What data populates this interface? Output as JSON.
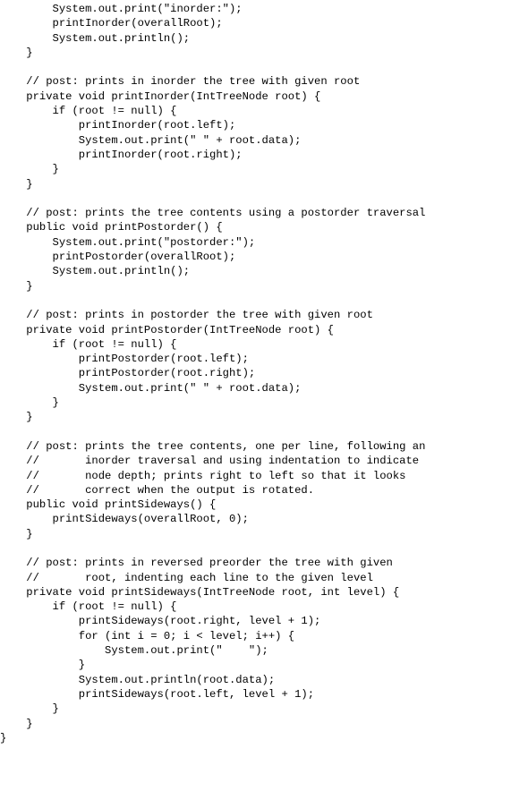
{
  "code": {
    "lines": [
      "        System.out.print(\"inorder:\");",
      "        printInorder(overallRoot);",
      "        System.out.println();",
      "    }",
      "",
      "    // post: prints in inorder the tree with given root",
      "    private void printInorder(IntTreeNode root) {",
      "        if (root != null) {",
      "            printInorder(root.left);",
      "            System.out.print(\" \" + root.data);",
      "            printInorder(root.right);",
      "        }",
      "    }",
      "",
      "    // post: prints the tree contents using a postorder traversal",
      "    public void printPostorder() {",
      "        System.out.print(\"postorder:\");",
      "        printPostorder(overallRoot);",
      "        System.out.println();",
      "    }",
      "",
      "    // post: prints in postorder the tree with given root",
      "    private void printPostorder(IntTreeNode root) {",
      "        if (root != null) {",
      "            printPostorder(root.left);",
      "            printPostorder(root.right);",
      "            System.out.print(\" \" + root.data);",
      "        }",
      "    }",
      "",
      "    // post: prints the tree contents, one per line, following an",
      "    //       inorder traversal and using indentation to indicate",
      "    //       node depth; prints right to left so that it looks",
      "    //       correct when the output is rotated.",
      "    public void printSideways() {",
      "        printSideways(overallRoot, 0);",
      "    }",
      "",
      "    // post: prints in reversed preorder the tree with given",
      "    //       root, indenting each line to the given level",
      "    private void printSideways(IntTreeNode root, int level) {",
      "        if (root != null) {",
      "            printSideways(root.right, level + 1);",
      "            for (int i = 0; i < level; i++) {",
      "                System.out.print(\"    \");",
      "            }",
      "            System.out.println(root.data);",
      "            printSideways(root.left, level + 1);",
      "        }",
      "    }",
      "}"
    ]
  }
}
